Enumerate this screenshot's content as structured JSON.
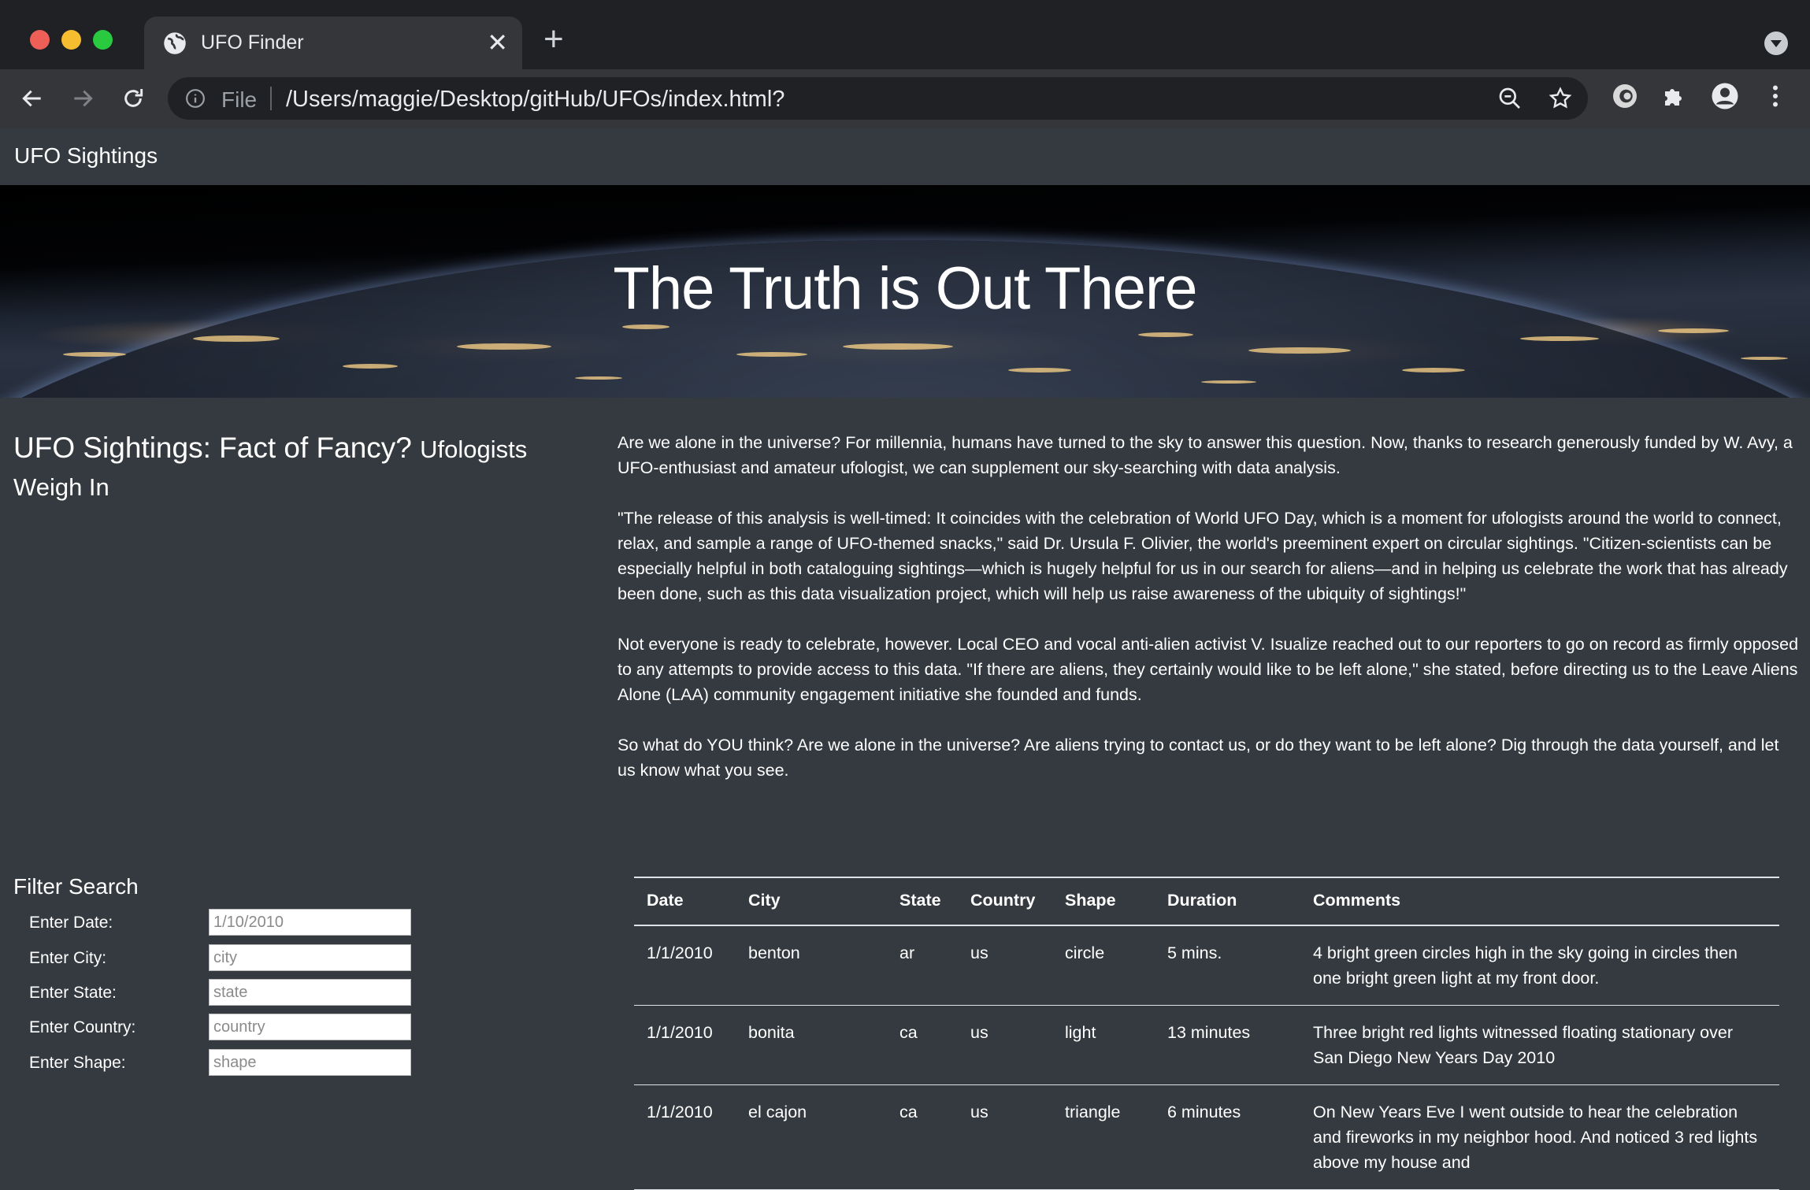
{
  "browser": {
    "tab_title": "UFO Finder",
    "file_label": "File",
    "url": "/Users/maggie/Desktop/gitHub/UFOs/index.html?"
  },
  "navbar": {
    "brand": "UFO Sightings"
  },
  "hero": {
    "title": "The Truth is Out There"
  },
  "article": {
    "title": "UFO Sightings: Fact of Fancy?",
    "subtitle": "Ufologists Weigh In",
    "paragraphs": [
      "Are we alone in the universe? For millennia, humans have turned to the sky to answer this question. Now, thanks to research generously funded by W. Avy, a UFO-enthusiast and amateur ufologist, we can supplement our sky-searching with data analysis.",
      "\"The release of this analysis is well-timed: It coincides with the celebration of World UFO Day, which is a moment for ufologists around the world to connect, relax, and sample a range of UFO-themed snacks,\" said Dr. Ursula F. Olivier, the world's preeminent expert on circular sightings. \"Citizen-scientists can be especially helpful in both cataloguing sightings—which is hugely helpful for us in our search for aliens—and in helping us celebrate the work that has already been done, such as this data visualization project, which will help us raise awareness of the ubiquity of sightings!\"",
      "Not everyone is ready to celebrate, however. Local CEO and vocal anti-alien activist V. Isualize reached out to our reporters to go on record as firmly opposed to any attempts to provide access to this data. \"If there are aliens, they certainly would like to be left alone,\" she stated, before directing us to the Leave Aliens Alone (LAA) community engagement initiative she founded and funds.",
      "So what do YOU think? Are we alone in the universe? Are aliens trying to contact us, or do they want to be left alone? Dig through the data yourself, and let us know what you see."
    ]
  },
  "filters": {
    "heading": "Filter Search",
    "date": {
      "label": "Enter Date:",
      "placeholder": "1/10/2010"
    },
    "city": {
      "label": "Enter City:",
      "placeholder": "city"
    },
    "state": {
      "label": "Enter State:",
      "placeholder": "state"
    },
    "country": {
      "label": "Enter Country:",
      "placeholder": "country"
    },
    "shape": {
      "label": "Enter Shape:",
      "placeholder": "shape"
    }
  },
  "table": {
    "headers": [
      "Date",
      "City",
      "State",
      "Country",
      "Shape",
      "Duration",
      "Comments"
    ],
    "rows": [
      [
        "1/1/2010",
        "benton",
        "ar",
        "us",
        "circle",
        "5 mins.",
        "4 bright green circles high in the sky going in circles then one bright green light at my front door."
      ],
      [
        "1/1/2010",
        "bonita",
        "ca",
        "us",
        "light",
        "13 minutes",
        "Three bright red lights witnessed floating stationary over San Diego New Years Day 2010"
      ],
      [
        "1/1/2010",
        "el cajon",
        "ca",
        "us",
        "triangle",
        "6 minutes",
        "On New Years Eve I went outside to hear the celebration and fireworks in my neighbor hood. And noticed 3 red lights above my house and"
      ]
    ]
  }
}
